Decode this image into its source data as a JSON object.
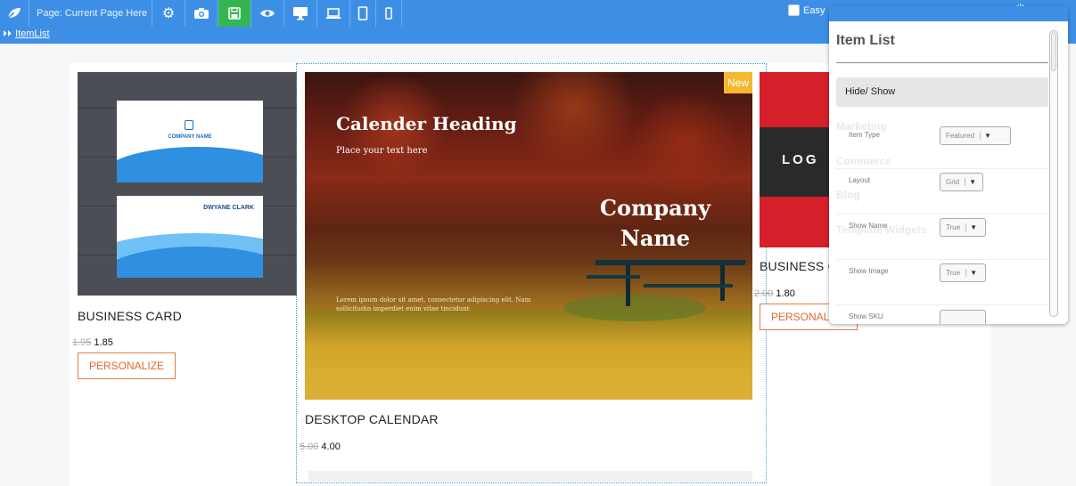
{
  "toolbar": {
    "page_label": "Page: Current Page Here",
    "easy_label": "Easy"
  },
  "breadcrumb": {
    "item": "ItemList"
  },
  "products": [
    {
      "title": "BUSINESS CARD",
      "old_price": "1.95",
      "price": "1.85",
      "button": "PERSONALIZE",
      "card_company": "COMPANY NAME",
      "card_person": "DWYANE CLARK"
    },
    {
      "title": "DESKTOP CALENDAR",
      "old_price": "5.00",
      "price": "4.00",
      "badge": "New",
      "heading": "Calender Heading",
      "subtext": "Place your text here",
      "company": "Company Name",
      "lorem": "Lorem ipsum dolor sit amet, consectetur adipiscing elit. Nam sollicitudin imperdiet enim vitae tincidunt"
    },
    {
      "title": "BUSINESS CA",
      "old_price": "2.00",
      "price": "1.80",
      "button": "PERSONALIZE",
      "logo": "LOG"
    }
  ],
  "panel": {
    "title": "Item List",
    "hide_show": "Hide/ Show",
    "ghost_menu": [
      "Marketing",
      "Commerce",
      "Blog",
      "Template Widgets"
    ],
    "props": [
      {
        "label": "Item Type",
        "value": "Featured"
      },
      {
        "label": "Layout",
        "value": "Grid"
      },
      {
        "label": "Show Name",
        "value": "True"
      },
      {
        "label": "Show Image",
        "value": "True"
      },
      {
        "label": "Show SKU",
        "value": ""
      }
    ]
  }
}
